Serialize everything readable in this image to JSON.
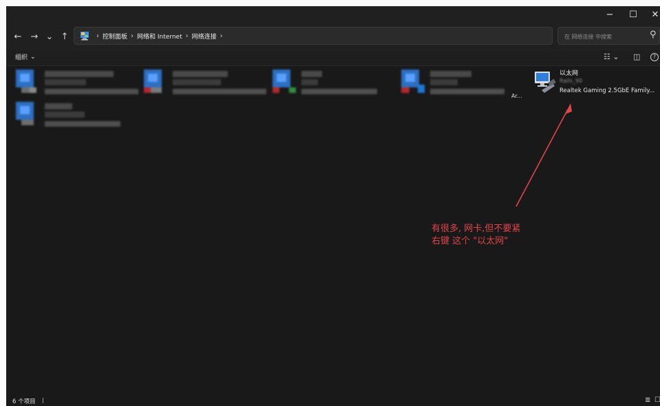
{
  "window": {
    "controls": {
      "minimize": "−",
      "maximize": "☐",
      "close": "✕"
    }
  },
  "nav": {
    "back": "←",
    "forward": "→",
    "recent": "⌄",
    "up": "↑"
  },
  "address": {
    "crumbs": [
      "控制面板",
      "网络和 Internet",
      "网络连接"
    ],
    "separator": "›",
    "dropdown": "⌄",
    "refresh": "↻"
  },
  "search": {
    "placeholder": "在 网络连接 中搜索",
    "icon": "⚲"
  },
  "command_bar": {
    "organize_label": "组织",
    "organize_chevron": "⌄",
    "view_options": "☷ ⌄",
    "details_pane": "◫",
    "help": "?"
  },
  "items": {
    "partial_text": "Ar...",
    "ethernet": {
      "name": "以太网",
      "status": "Rails_90",
      "adapter": "Realtek Gaming 2.5GbE Family..."
    }
  },
  "annotation": {
    "text": "有很多, 网卡,但不要紧\n右键 这个 \"以太网\"",
    "color": "#e0454b"
  },
  "status_bar": {
    "count": "6 个项目",
    "details_view": "≣",
    "tiles_view": "☐"
  },
  "colors": {
    "background": "#191919",
    "accent": "#1e78d7",
    "annotation": "#e0454b"
  }
}
